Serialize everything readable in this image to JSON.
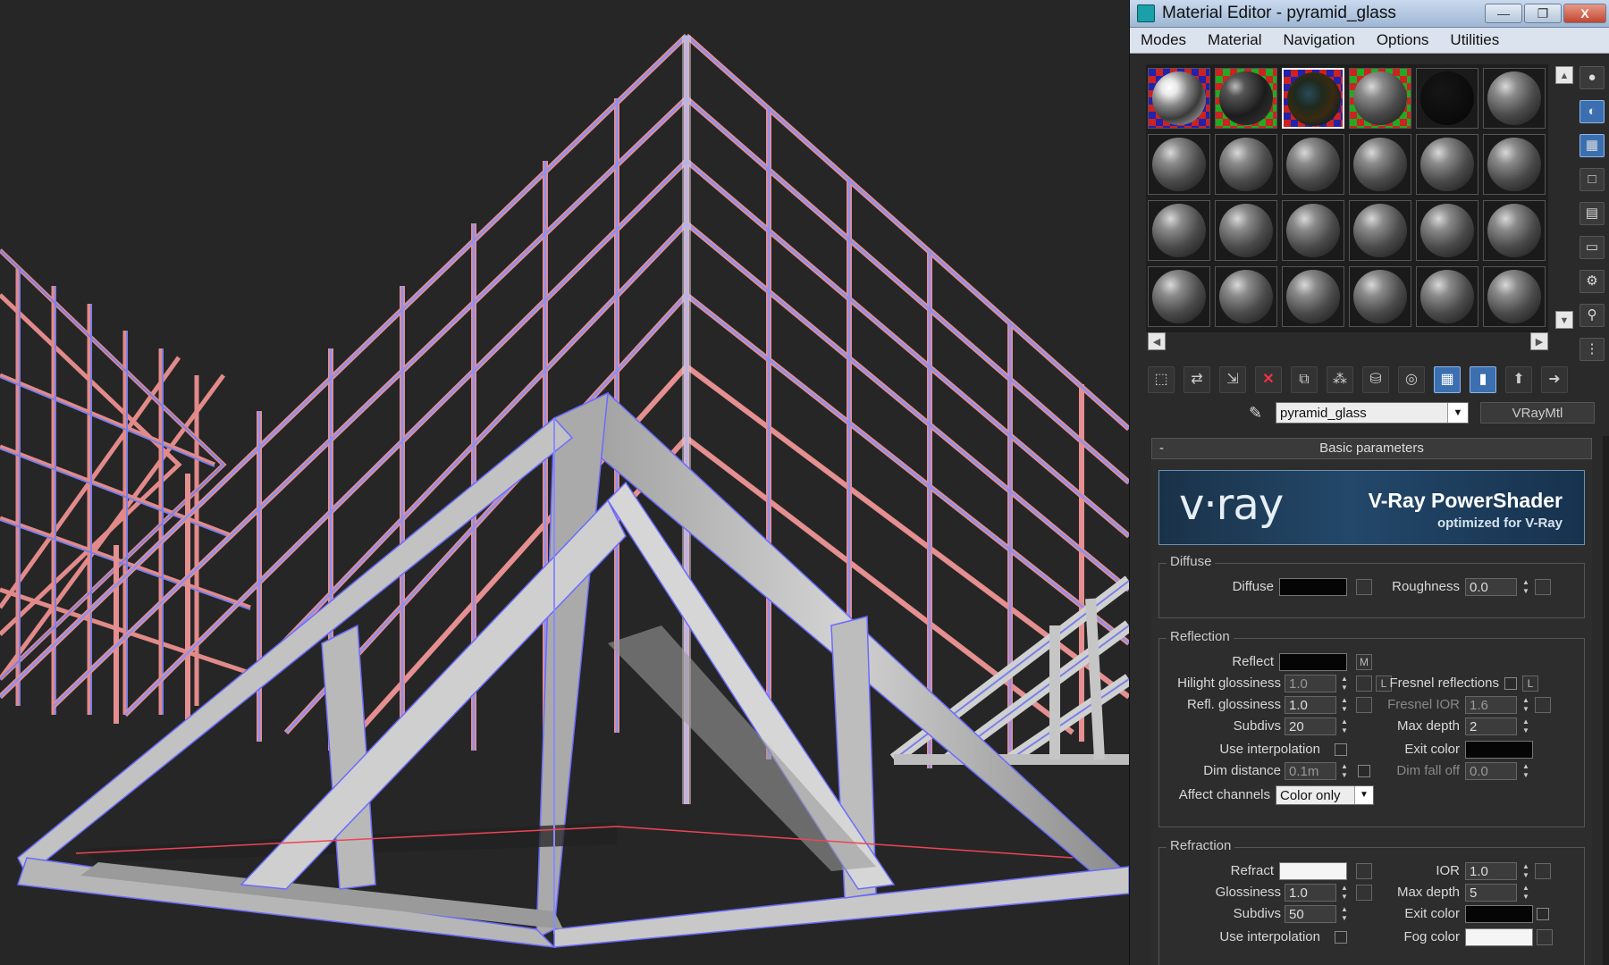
{
  "window": {
    "title": "Material Editor - pyramid_glass",
    "minimize": "—",
    "maximize": "❐",
    "close": "X"
  },
  "menu": [
    "Modes",
    "Material",
    "Navigation",
    "Options",
    "Utilities"
  ],
  "material": {
    "name": "pyramid_glass",
    "type": "VRayMtl"
  },
  "rollout": {
    "title": "Basic parameters",
    "collapse": "-"
  },
  "banner": {
    "logo": "v·ray",
    "title": "V-Ray PowerShader",
    "subtitle": "optimized for V-Ray"
  },
  "diffuse": {
    "group": "Diffuse",
    "diffuse_label": "Diffuse",
    "diffuse_color": "#050505",
    "roughness_label": "Roughness",
    "roughness": "0.0"
  },
  "reflection": {
    "group": "Reflection",
    "reflect_label": "Reflect",
    "reflect_color": "#050505",
    "reflect_map": "M",
    "hilight_label": "Hilight glossiness",
    "hilight": "1.0",
    "lock_label": "L",
    "fresnel_label": "Fresnel reflections",
    "fresnel_lock": "L",
    "refl_gloss_label": "Refl. glossiness",
    "refl_gloss": "1.0",
    "fresnel_ior_label": "Fresnel IOR",
    "fresnel_ior": "1.6",
    "subdivs_label": "Subdivs",
    "subdivs": "20",
    "max_depth_label": "Max depth",
    "max_depth": "2",
    "use_interp_label": "Use interpolation",
    "exit_color_label": "Exit color",
    "exit_color": "#050505",
    "dim_distance_label": "Dim distance",
    "dim_distance": "0.1m",
    "dim_falloff_label": "Dim fall off",
    "dim_falloff": "0.0",
    "affect_label": "Affect channels",
    "affect_value": "Color only"
  },
  "refraction": {
    "group": "Refraction",
    "refract_label": "Refract",
    "refract_color": "#f5f5f5",
    "ior_label": "IOR",
    "ior": "1.0",
    "gloss_label": "Glossiness",
    "gloss": "1.0",
    "max_depth_label": "Max depth",
    "max_depth": "5",
    "subdivs_label": "Subdivs",
    "subdivs": "50",
    "exit_color_label": "Exit color",
    "exit_color": "#050505",
    "use_interp_label": "Use interpolation",
    "fog_color_label": "Fog color",
    "fog_color": "#f5f5f5"
  }
}
